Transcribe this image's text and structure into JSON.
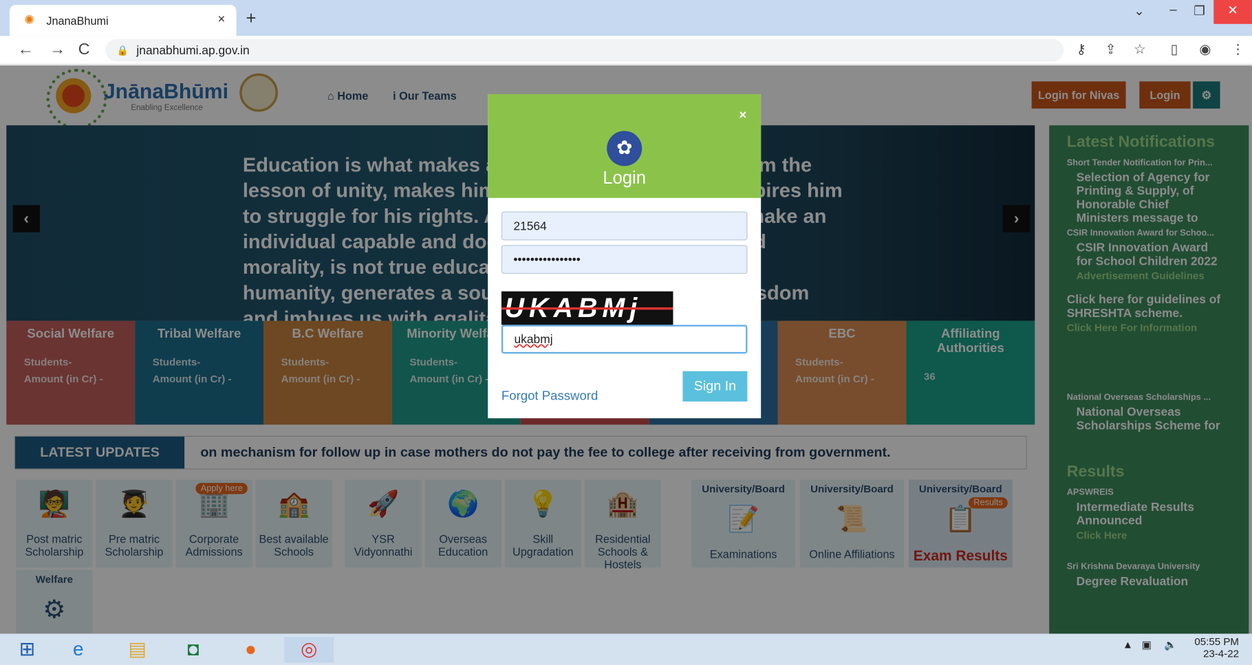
{
  "browser": {
    "tab_title": "JnanaBhumi",
    "tab_close": "×",
    "new_tab": "+",
    "url": "jnanabhumi.ap.gov.in",
    "nav_back": "←",
    "nav_forward": "→",
    "nav_reload": "C",
    "ctl_chevron": "⌄",
    "ctl_minimize": "–",
    "ctl_restore": "❐",
    "ctl_close": "✕"
  },
  "header": {
    "logo_text": "JnānaBhūmi",
    "logo_tagline": "Enabling Excellence",
    "menu": [
      {
        "label": "Home",
        "icon": "home-icon"
      },
      {
        "label": "Our Teams",
        "icon": "info-icon"
      }
    ],
    "login_nivas": "Login for Nivas",
    "login": "Login",
    "settings_icon": "⚙"
  },
  "slider": {
    "quote": "Education is what makes a person fearless, teaches him the lesson of unity, makes him aware of his rights and inspires him to struggle for his rights. An education that does not make an individual capable and does not teach him equality and morality, is not true education. True education cradles humanity, generates a source of livelihood, imparts wisdom and imbues us with egalitarianism.",
    "prev": "‹",
    "next": "›"
  },
  "tiles": [
    {
      "title": "Social Welfare",
      "students": "Students-",
      "amount": "Amount (in Cr) -",
      "color": "#c2605c"
    },
    {
      "title": "Tribal Welfare",
      "students": "Students-",
      "amount": "Amount (in Cr) -",
      "color": "#1d6f8c"
    },
    {
      "title": "B.C Welfare",
      "students": "Students-",
      "amount": "Amount (in Cr) -",
      "color": "#c9843e"
    },
    {
      "title": "Minority Welfare",
      "students": "Students-",
      "amount": "Amount (in Cr) -",
      "color": "#219b8a"
    },
    {
      "title": "",
      "students": "",
      "amount": "",
      "color": "#c74a4a"
    },
    {
      "title": "",
      "students": "",
      "amount": "",
      "color": "#2d6fa0"
    },
    {
      "title": "EBC",
      "students": "Students-",
      "amount": "Amount (in Cr) -",
      "color": "#d98c52"
    },
    {
      "title": "Affiliating Authorities",
      "students": "36",
      "amount": "",
      "color": "#1ba08a"
    }
  ],
  "updates": {
    "label": "LATEST UPDATES",
    "message": "on mechanism for follow up in case mothers do not pay the fee to college after receiving from government."
  },
  "services": [
    {
      "label": "Post matric Scholarship",
      "icon": "scholarship-icon"
    },
    {
      "label": "Pre matric Scholarship",
      "icon": "student-icon"
    },
    {
      "label": "Corporate Admissions",
      "icon": "admission-icon",
      "badge": "Apply here"
    },
    {
      "label": "Best available Schools",
      "icon": "school-icon"
    },
    {
      "label": "YSR Vidyonnathi",
      "icon": "rocket-icon"
    },
    {
      "label": "Overseas Education",
      "icon": "globe-icon"
    },
    {
      "label": "Skill Upgradation",
      "icon": "bulb-icon"
    },
    {
      "label": "Residential Schools & Hostels",
      "icon": "hostel-icon"
    },
    {
      "label": "Examinations",
      "icon": "exam-icon",
      "head": "University/Board"
    },
    {
      "label": "Online Affiliations",
      "icon": "affiliation-icon",
      "head": "University/Board"
    },
    {
      "label": "Exam Results",
      "icon": "results-icon",
      "head": "University/Board",
      "badge": "Results"
    },
    {
      "label": "Welfare",
      "icon": "welfare-icon"
    }
  ],
  "notifications": {
    "heading": "Latest Notifications",
    "items": [
      {
        "small": "Short Tender Notification for Prin...",
        "big": "Selection of Agency for Printing & Supply, of Honorable Chief Ministers message to mothers of eligible students"
      },
      {
        "small": "CSIR Innovation Award for Schoo...",
        "big": "CSIR Innovation Award for School Children 2022",
        "links": "Advertisement   Guidelines"
      },
      {
        "small": "",
        "big": "Click here for guidelines of SHRESHTA scheme.",
        "links": "Click Here For Information"
      },
      {
        "small": "National Overseas Scholarships ...",
        "big": "National Overseas Scholarships Scheme for"
      }
    ],
    "results_heading": "Results",
    "results": [
      {
        "small": "APSWREIS",
        "big": "Intermediate Results Announced",
        "links": "Click Here"
      },
      {
        "small": "Sri Krishna Devaraya University",
        "big": "Degree Revaluation"
      }
    ]
  },
  "modal": {
    "title": "Login",
    "close": "×",
    "username_value": "21564",
    "password_value": "••••••••••••••••",
    "captcha_text": "UKABMj",
    "captcha_value": "ukabmj",
    "sign_in": "Sign In",
    "forgot": "Forgot Password",
    "header_color": "#8bc34a"
  },
  "taskbar": {
    "time": "05:55 PM",
    "date": "23-4-22"
  }
}
